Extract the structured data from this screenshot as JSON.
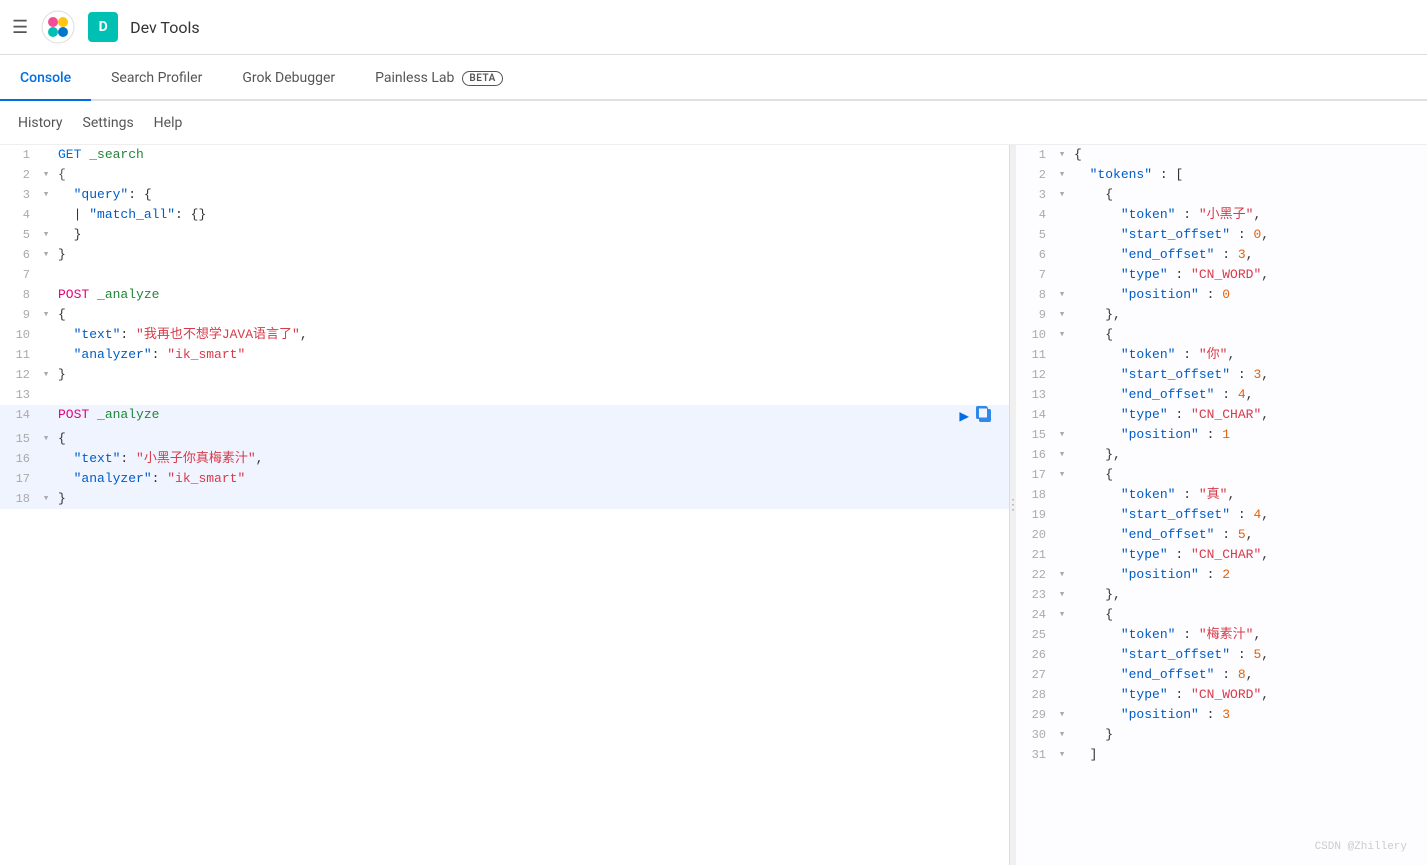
{
  "topbar": {
    "title": "Dev Tools",
    "avatar_label": "D",
    "menu_icon": "☰"
  },
  "nav_tabs": [
    {
      "id": "console",
      "label": "Console",
      "active": true,
      "beta": false
    },
    {
      "id": "search-profiler",
      "label": "Search Profiler",
      "active": false,
      "beta": false
    },
    {
      "id": "grok-debugger",
      "label": "Grok Debugger",
      "active": false,
      "beta": false
    },
    {
      "id": "painless-lab",
      "label": "Painless Lab",
      "active": false,
      "beta": true
    }
  ],
  "sub_toolbar": [
    {
      "id": "history",
      "label": "History"
    },
    {
      "id": "settings",
      "label": "Settings"
    },
    {
      "id": "help",
      "label": "Help"
    }
  ],
  "editor": {
    "lines": [
      {
        "num": "1",
        "fold": " ",
        "content": "<span class='kw-method'>GET</span> <span class='kw-url'>_search</span>"
      },
      {
        "num": "2",
        "fold": "▾",
        "content": "<span class='kw-brace'>{</span>"
      },
      {
        "num": "3",
        "fold": "▾",
        "content": "  <span class='kw-key'>\"query\"</span>: {"
      },
      {
        "num": "4",
        "fold": " ",
        "content": "  | <span class='kw-key'>\"match_all\"</span>: {}"
      },
      {
        "num": "5",
        "fold": "▾",
        "content": "  }"
      },
      {
        "num": "6",
        "fold": "▾",
        "content": "}"
      },
      {
        "num": "7",
        "fold": " ",
        "content": ""
      },
      {
        "num": "8",
        "fold": " ",
        "content": "<span class='kw-method'>POST</span> <span class='kw-url'>_analyze</span>"
      },
      {
        "num": "9",
        "fold": "▾",
        "content": "{"
      },
      {
        "num": "10",
        "fold": " ",
        "content": "  <span class='kw-key'>\"text\"</span>: <span class='kw-string'>\"我再也不想学JAVA语言了\"</span>,"
      },
      {
        "num": "11",
        "fold": " ",
        "content": "  <span class='kw-key'>\"analyzer\"</span>: <span class='kw-string'>\"ik_smart\"</span>"
      },
      {
        "num": "12",
        "fold": "▾",
        "content": "}"
      },
      {
        "num": "13",
        "fold": " ",
        "content": ""
      },
      {
        "num": "14",
        "fold": " ",
        "content": "<span class='kw-post'>POST</span> <span class='kw-url'>_analyze</span>",
        "highlighted": true
      },
      {
        "num": "15",
        "fold": "▾",
        "content": "{",
        "highlighted": true
      },
      {
        "num": "16",
        "fold": " ",
        "content": "  <span class='kw-key'>\"text\"</span>: <span class='kw-string'>\"小黑子你真梅素汁\"</span>,",
        "highlighted": true
      },
      {
        "num": "17",
        "fold": " ",
        "content": "  <span class='kw-key'>\"analyzer\"</span>: <span class='kw-string'>\"ik_smart\"</span>",
        "highlighted": true
      },
      {
        "num": "18",
        "fold": "▾",
        "content": "}",
        "highlighted": true
      }
    ]
  },
  "output": {
    "lines": [
      {
        "num": "1",
        "fold": "▾",
        "content": "{"
      },
      {
        "num": "2",
        "fold": "▾",
        "content": "  <span class='out-key'>\"tokens\"</span> : ["
      },
      {
        "num": "3",
        "fold": "▾",
        "content": "    {"
      },
      {
        "num": "4",
        "fold": " ",
        "content": "      <span class='out-key'>\"token\"</span> : <span class='out-string'>\"小黑子\"</span>,"
      },
      {
        "num": "5",
        "fold": " ",
        "content": "      <span class='out-key'>\"start_offset\"</span> : <span class='out-number'>0</span>,"
      },
      {
        "num": "6",
        "fold": " ",
        "content": "      <span class='out-key'>\"end_offset\"</span> : <span class='out-number'>3</span>,"
      },
      {
        "num": "7",
        "fold": " ",
        "content": "      <span class='out-key'>\"type\"</span> : <span class='out-string'>\"CN_WORD\"</span>,"
      },
      {
        "num": "8",
        "fold": "▾",
        "content": "      <span class='out-key'>\"position\"</span> : <span class='out-number'>0</span>"
      },
      {
        "num": "9",
        "fold": "▾",
        "content": "    },"
      },
      {
        "num": "10",
        "fold": "▾",
        "content": "    {"
      },
      {
        "num": "11",
        "fold": " ",
        "content": "      <span class='out-key'>\"token\"</span> : <span class='out-string'>\"你\"</span>,"
      },
      {
        "num": "12",
        "fold": " ",
        "content": "      <span class='out-key'>\"start_offset\"</span> : <span class='out-number'>3</span>,"
      },
      {
        "num": "13",
        "fold": " ",
        "content": "      <span class='out-key'>\"end_offset\"</span> : <span class='out-number'>4</span>,"
      },
      {
        "num": "14",
        "fold": " ",
        "content": "      <span class='out-key'>\"type\"</span> : <span class='out-string'>\"CN_CHAR\"</span>,"
      },
      {
        "num": "15",
        "fold": "▾",
        "content": "      <span class='out-key'>\"position\"</span> : <span class='out-number'>1</span>"
      },
      {
        "num": "16",
        "fold": "▾",
        "content": "    },"
      },
      {
        "num": "17",
        "fold": "▾",
        "content": "    {"
      },
      {
        "num": "18",
        "fold": " ",
        "content": "      <span class='out-key'>\"token\"</span> : <span class='out-string'>\"真\"</span>,"
      },
      {
        "num": "19",
        "fold": " ",
        "content": "      <span class='out-key'>\"start_offset\"</span> : <span class='out-number'>4</span>,"
      },
      {
        "num": "20",
        "fold": " ",
        "content": "      <span class='out-key'>\"end_offset\"</span> : <span class='out-number'>5</span>,"
      },
      {
        "num": "21",
        "fold": " ",
        "content": "      <span class='out-key'>\"type\"</span> : <span class='out-string'>\"CN_CHAR\"</span>,"
      },
      {
        "num": "22",
        "fold": "▾",
        "content": "      <span class='out-key'>\"position\"</span> : <span class='out-number'>2</span>"
      },
      {
        "num": "23",
        "fold": "▾",
        "content": "    },"
      },
      {
        "num": "24",
        "fold": "▾",
        "content": "    {"
      },
      {
        "num": "25",
        "fold": " ",
        "content": "      <span class='out-key'>\"token\"</span> : <span class='out-string'>\"梅素汁\"</span>,"
      },
      {
        "num": "26",
        "fold": " ",
        "content": "      <span class='out-key'>\"start_offset\"</span> : <span class='out-number'>5</span>,"
      },
      {
        "num": "27",
        "fold": " ",
        "content": "      <span class='out-key'>\"end_offset\"</span> : <span class='out-number'>8</span>,"
      },
      {
        "num": "28",
        "fold": " ",
        "content": "      <span class='out-key'>\"type\"</span> : <span class='out-string'>\"CN_WORD\"</span>,"
      },
      {
        "num": "29",
        "fold": "▾",
        "content": "      <span class='out-key'>\"position\"</span> : <span class='out-number'>3</span>"
      },
      {
        "num": "30",
        "fold": "▾",
        "content": "    }"
      },
      {
        "num": "31",
        "fold": "▾",
        "content": "  ]"
      }
    ]
  },
  "watermark": "CSDN @Zhillery"
}
